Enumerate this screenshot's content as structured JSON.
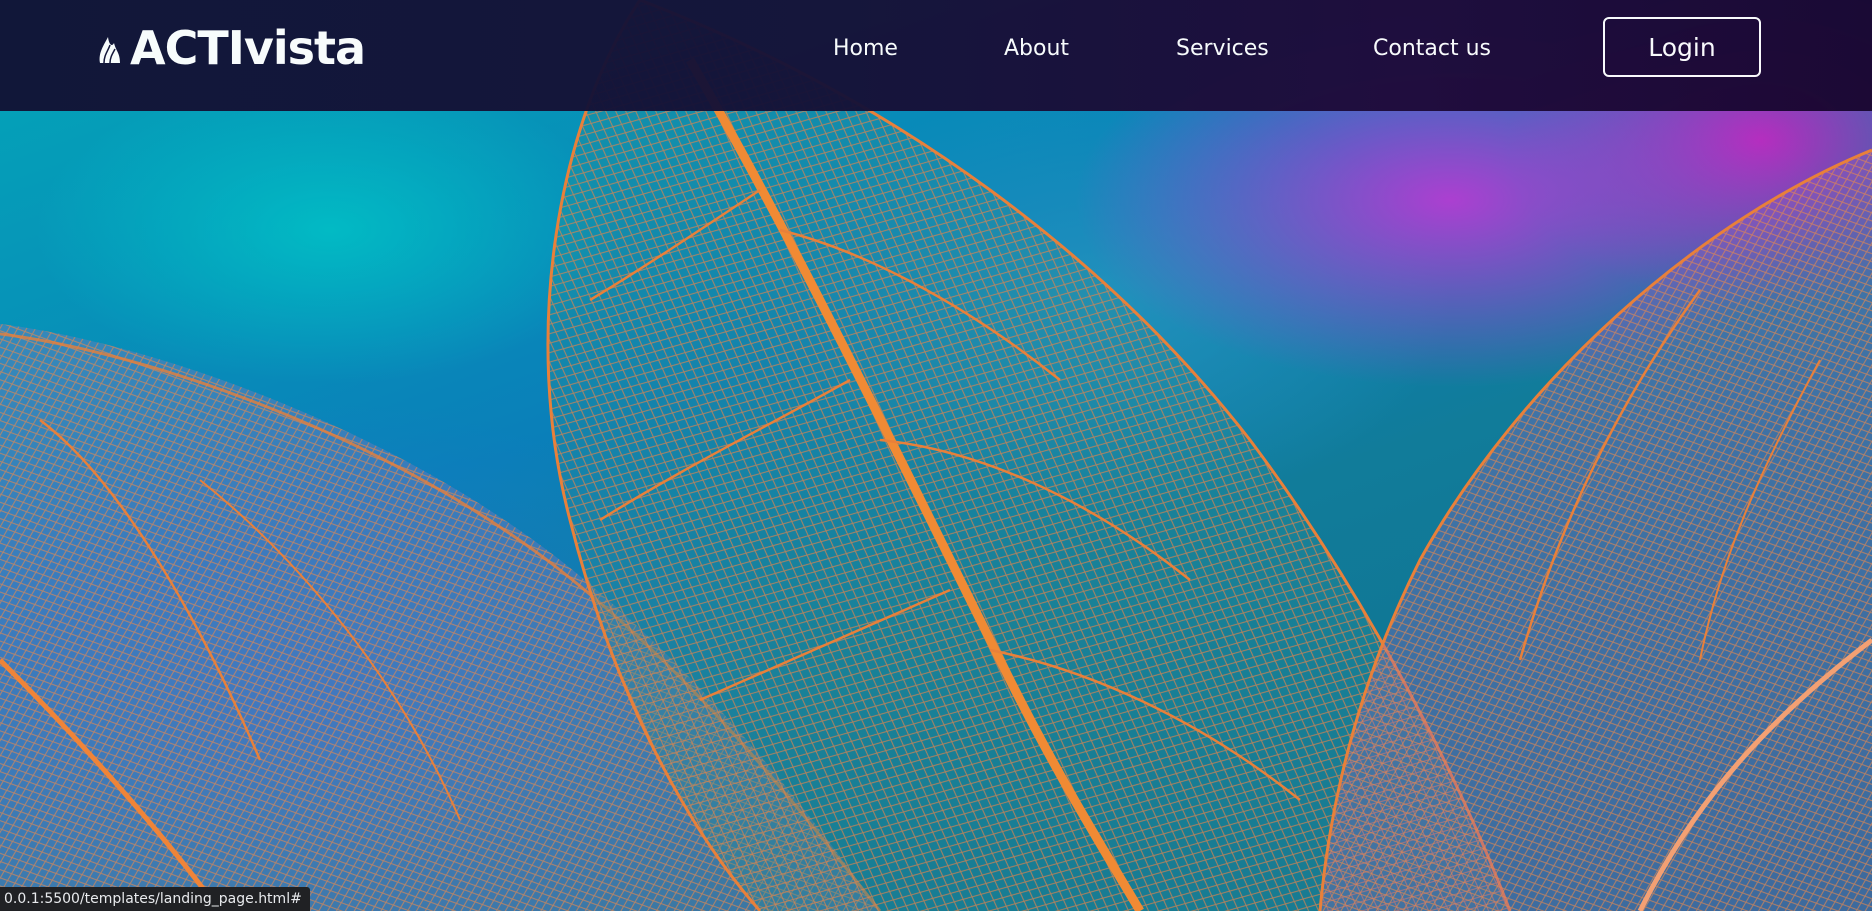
{
  "brand": {
    "name": "ACTIvista",
    "icon": "flame-leaf-icon"
  },
  "nav": {
    "items": [
      {
        "label": "Home"
      },
      {
        "label": "About"
      },
      {
        "label": "Services"
      },
      {
        "label": "Contact us"
      }
    ],
    "login_label": "Login"
  },
  "hero": {
    "image_alt": "Backlit skeleton leaves with orange veins over teal and purple background"
  },
  "status_bar": {
    "url": "0.0.1:5500/templates/landing_page.html#"
  },
  "colors": {
    "navbar_bg": "#141235",
    "vein": "#e8803a",
    "teal": "#0aa3b5",
    "purple": "#b040d0"
  }
}
